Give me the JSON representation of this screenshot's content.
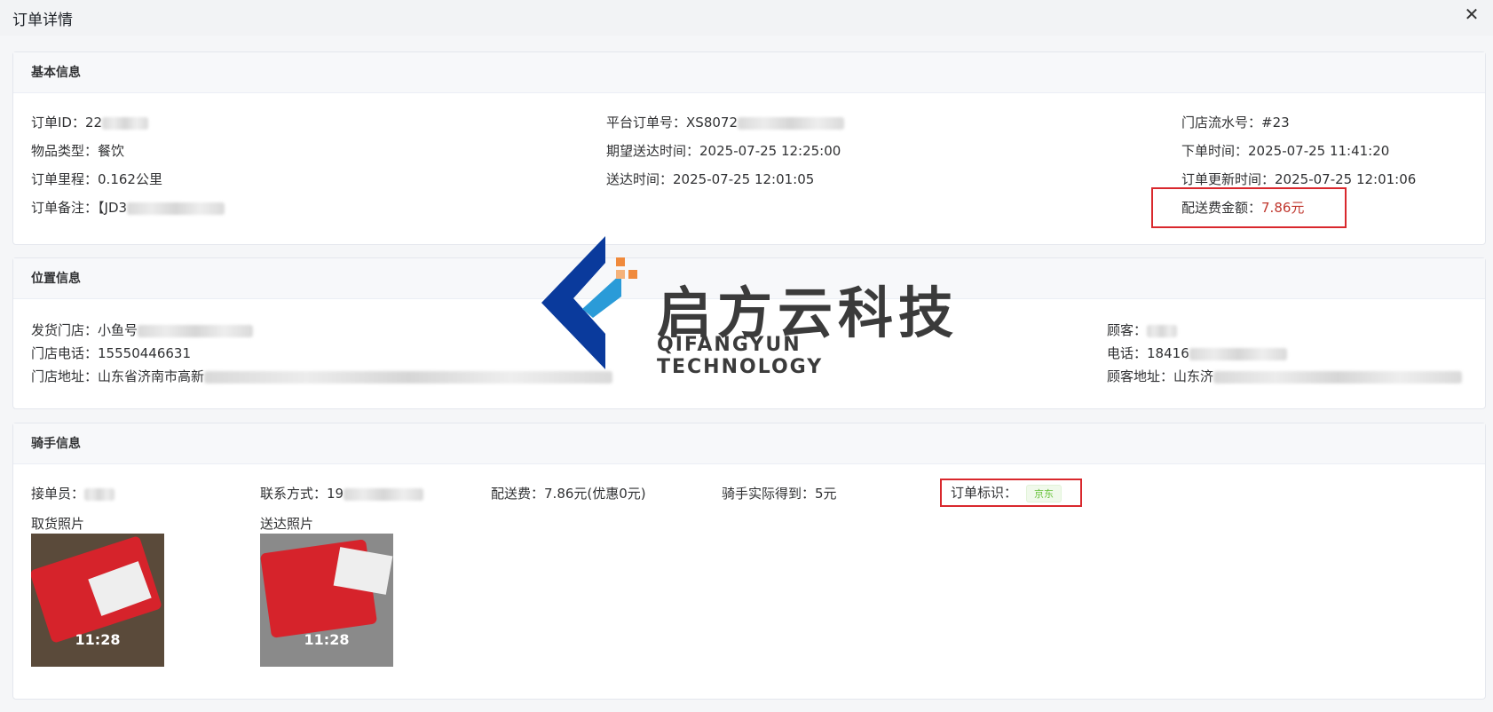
{
  "dialog": {
    "title": "订单详情",
    "close_label": "✕"
  },
  "basic": {
    "header": "基本信息",
    "order_id_label": "订单ID：",
    "order_id_value": "22",
    "platform_no_label": "平台订单号：",
    "platform_no_value": "XS8072",
    "store_serial_label": "门店流水号：",
    "store_serial_value": "#23",
    "item_type_label": "物品类型：",
    "item_type_value": "餐饮",
    "expected_time_label": "期望送达时间：",
    "expected_time_value": "2025-07-25 12:25:00",
    "order_time_label": "下单时间：",
    "order_time_value": "2025-07-25 11:41:20",
    "distance_label": "订单里程：",
    "distance_value": "0.162公里",
    "delivered_time_label": "送达时间：",
    "delivered_time_value": "2025-07-25 12:01:05",
    "updated_time_label": "订单更新时间：",
    "updated_time_value": "2025-07-25 12:01:06",
    "remark_label": "订单备注：",
    "remark_value": "【JD3",
    "fee_label": "配送费金额：",
    "fee_value": "7.86元"
  },
  "location": {
    "header": "位置信息",
    "store_label": "发货门店：",
    "store_value": "小鱼号",
    "store_phone_label": "门店电话：",
    "store_phone_value": "15550446631",
    "store_addr_label": "门店地址：",
    "store_addr_value": "山东省济南市高新",
    "customer_label": "顾客：",
    "customer_phone_label": "电话：",
    "customer_phone_value": "18416",
    "customer_addr_label": "顾客地址：",
    "customer_addr_value": "山东济"
  },
  "rider": {
    "header": "骑手信息",
    "receiver_label": "接单员：",
    "contact_label": "联系方式：",
    "contact_value": "19",
    "fee_label": "配送费：",
    "fee_value": "7.86元(优惠0元)",
    "actual_label": "骑手实际得到：",
    "actual_value": "5元",
    "order_tag_label": "订单标识：",
    "order_tag_value": "京东",
    "pickup_photo_label": "取货照片",
    "delivery_photo_label": "送达照片",
    "photo_time": "11:28"
  },
  "watermark": {
    "name": "启方云科技",
    "sub": "QIFANGYUN TECHNOLOGY"
  },
  "colors": {
    "accent_red": "#c0372e",
    "highlight_box": "#d9282d",
    "tag_green": "#67c23a",
    "logo_blue": "#0a3a9c",
    "logo_orange": "#f08a3c"
  }
}
